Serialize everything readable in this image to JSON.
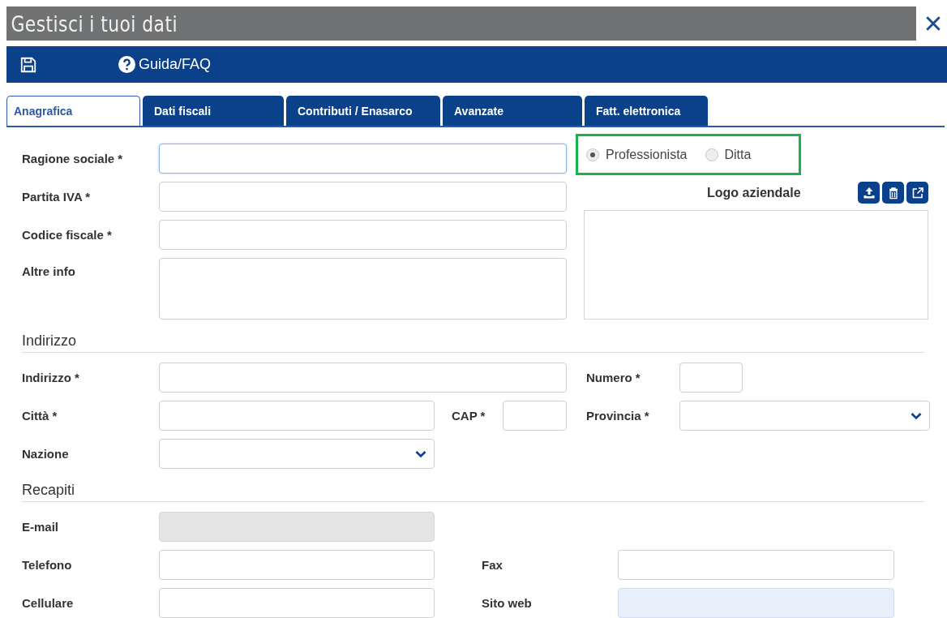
{
  "window": {
    "title": "Gestisci i tuoi dati"
  },
  "toolbar": {
    "help": "Guida/FAQ"
  },
  "tabs": [
    {
      "label": "Anagrafica",
      "selected": true
    },
    {
      "label": "Dati fiscali",
      "selected": false
    },
    {
      "label": "Contributi / Enasarco",
      "selected": false
    },
    {
      "label": "Avanzate",
      "selected": false
    },
    {
      "label": "Fatt. elettronica",
      "selected": false
    }
  ],
  "general": [
    {
      "label": "Ragione sociale *",
      "kind": "text",
      "focused": true
    },
    {
      "label": "Partita IVA *",
      "kind": "text",
      "focused": false
    },
    {
      "label": "Codice fiscale *",
      "kind": "text",
      "focused": false
    },
    {
      "label": "Altre info",
      "kind": "textarea",
      "focused": false
    }
  ],
  "type_options": [
    {
      "label": "Professionista",
      "selected": true
    },
    {
      "label": "Ditta",
      "selected": false
    }
  ],
  "logo": {
    "label": "Logo aziendale"
  },
  "address": {
    "title": "Indirizzo",
    "fields": [
      {
        "label": "Indirizzo *",
        "kind": "text"
      },
      {
        "label": "Numero *",
        "kind": "text"
      },
      {
        "label": "Città *",
        "kind": "text"
      },
      {
        "label": "CAP *",
        "kind": "text"
      },
      {
        "label": "Provincia *",
        "kind": "select"
      },
      {
        "label": "Nazione",
        "kind": "select"
      }
    ]
  },
  "contacts": {
    "title": "Recapiti",
    "fields": [
      {
        "label": "E-mail",
        "kind": "text",
        "disabled": true,
        "autofilled": false
      },
      {
        "label": "Telefono",
        "kind": "text",
        "disabled": false,
        "autofilled": false
      },
      {
        "label": "Fax",
        "kind": "text",
        "disabled": false,
        "autofilled": false
      },
      {
        "label": "Cellulare",
        "kind": "text",
        "disabled": false,
        "autofilled": false
      },
      {
        "label": "Sito web",
        "kind": "text",
        "disabled": false,
        "autofilled": true
      }
    ]
  }
}
